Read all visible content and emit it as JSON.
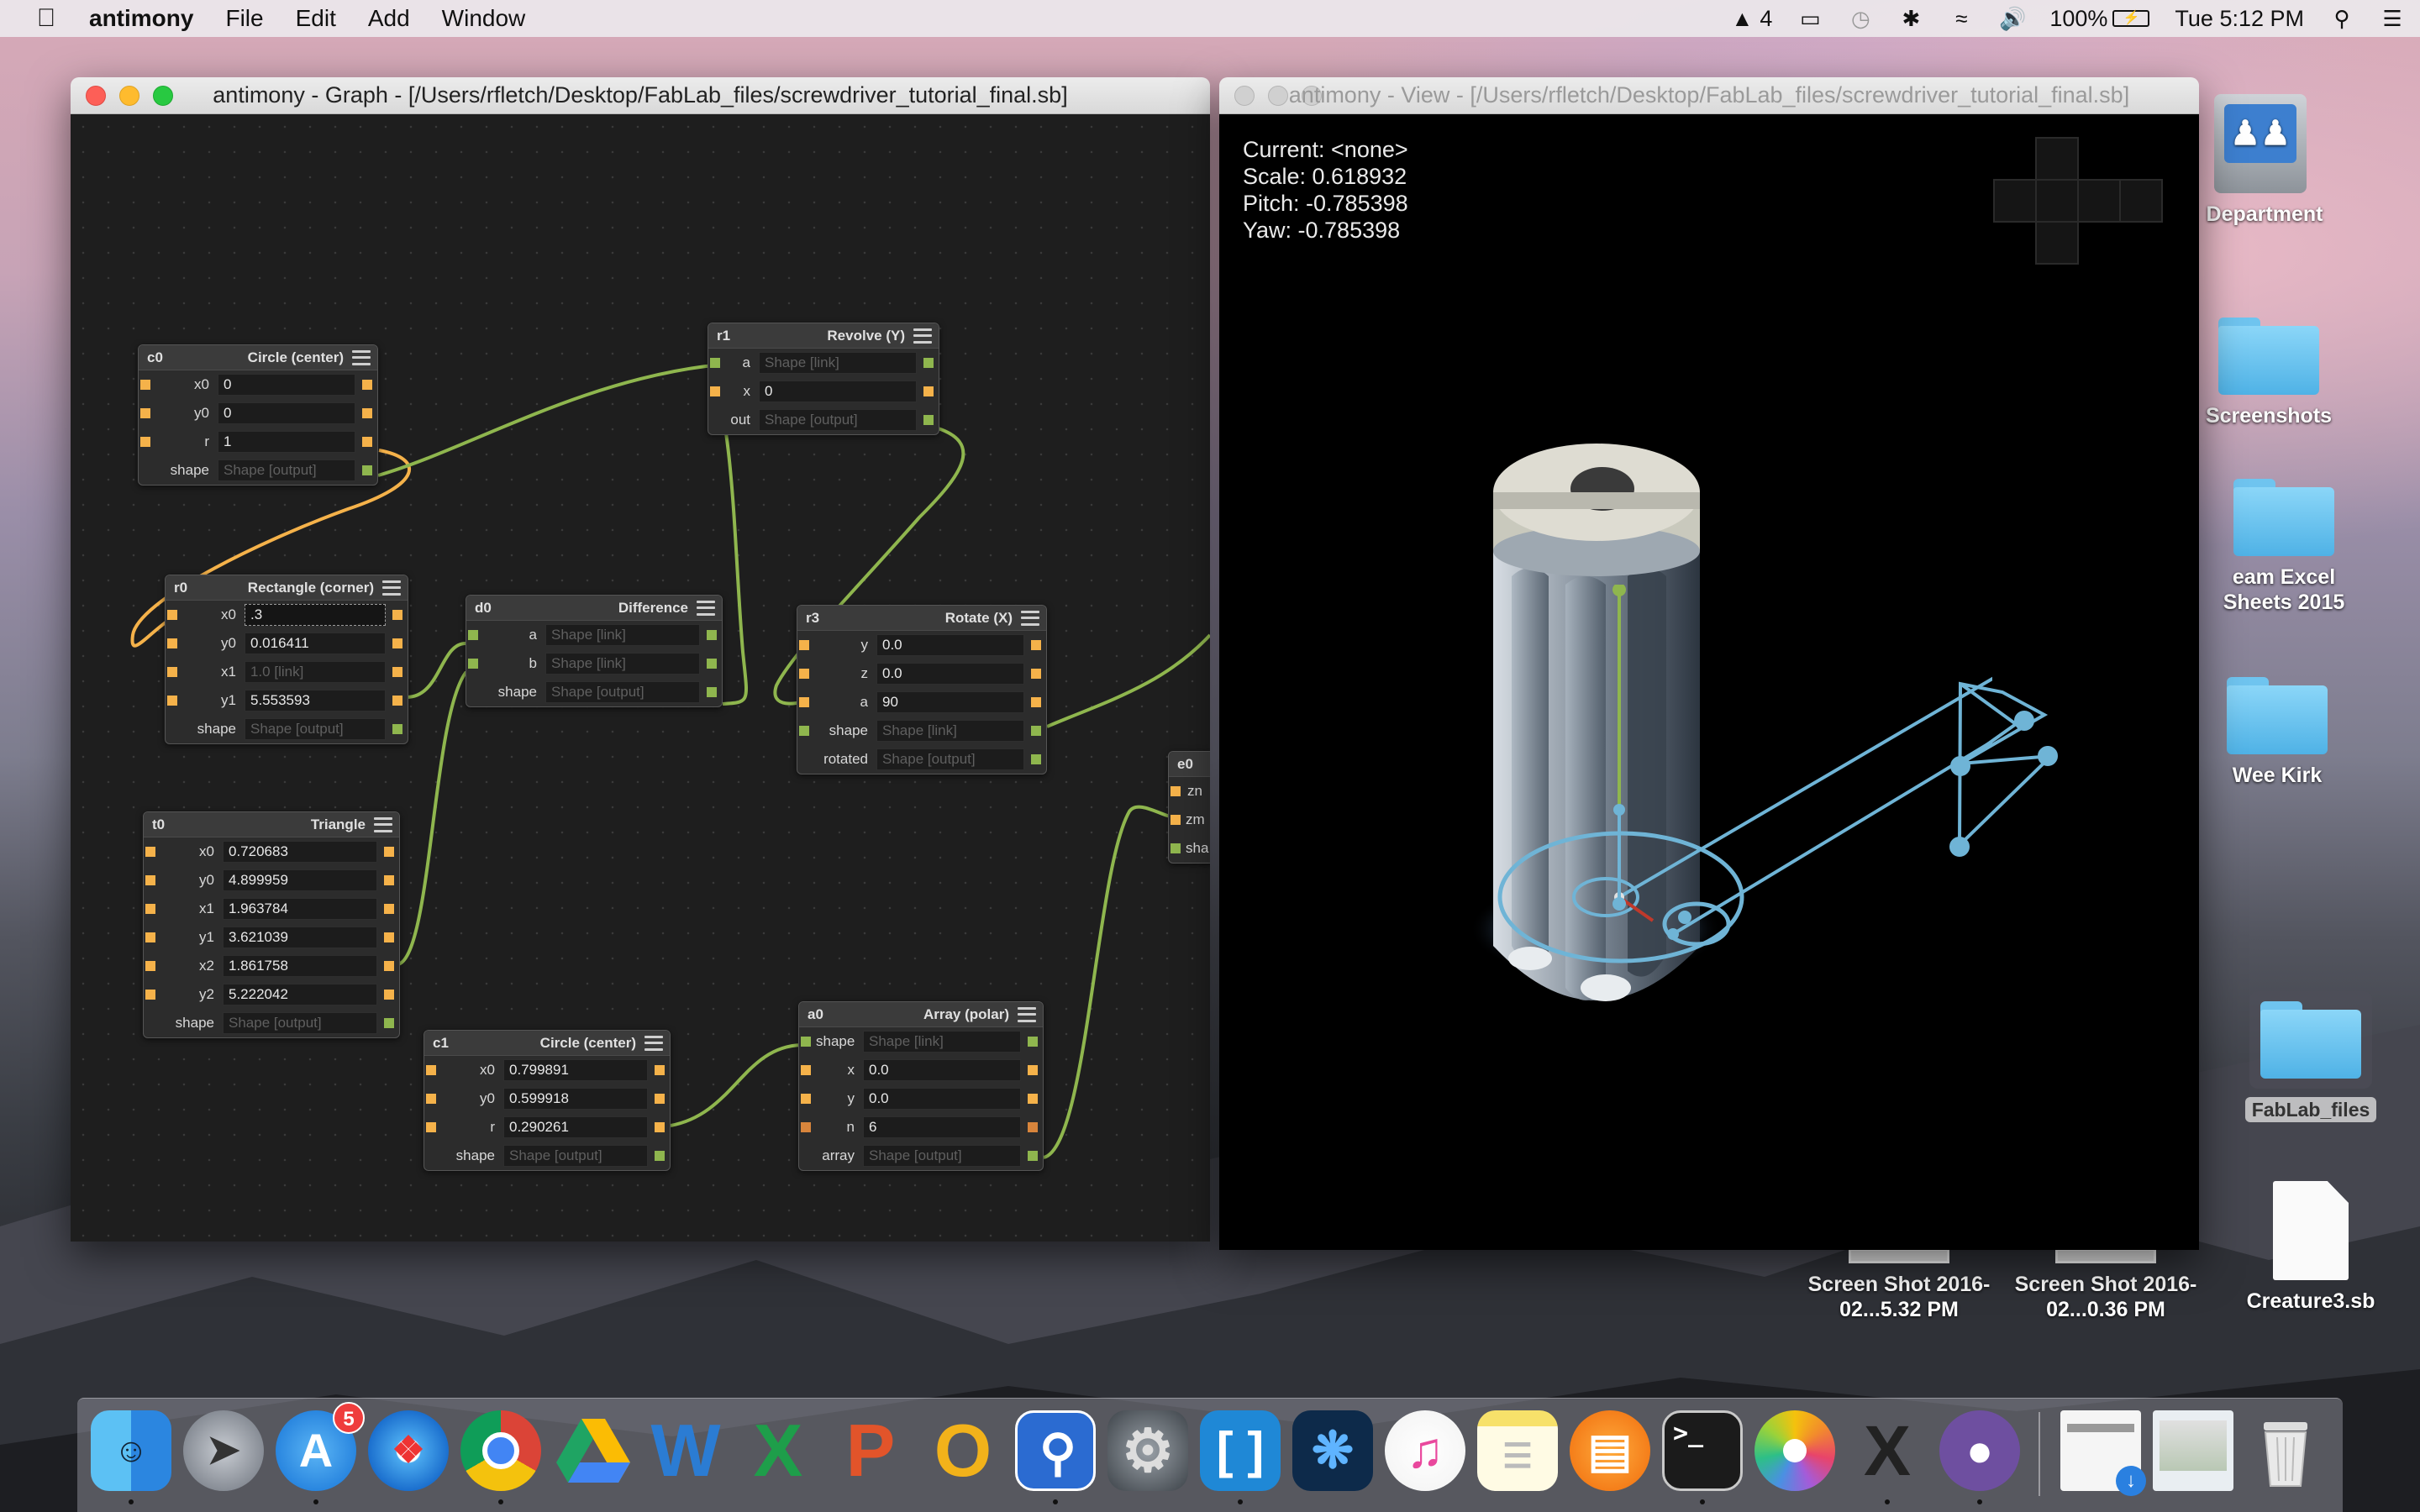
{
  "menubar": {
    "app_name": "antimony",
    "menus": [
      "File",
      "Edit",
      "Add",
      "Window"
    ],
    "adobe_badge": "4",
    "battery": "100%",
    "clock": "Tue 5:12 PM"
  },
  "graph_window": {
    "title": "antimony - Graph - [/Users/rfletch/Desktop/FabLab_files/screwdriver_tutorial_final.sb]",
    "nodes": {
      "c0": {
        "name": "c0",
        "type": "Circle (center)",
        "rows": [
          {
            "label": "x0",
            "value": "0"
          },
          {
            "label": "y0",
            "value": "0"
          },
          {
            "label": "r",
            "value": "1"
          },
          {
            "label": "shape",
            "value": "Shape [output]"
          }
        ]
      },
      "r0": {
        "name": "r0",
        "type": "Rectangle (corner)",
        "rows": [
          {
            "label": "x0",
            "value": ".3"
          },
          {
            "label": "y0",
            "value": "0.016411"
          },
          {
            "label": "x1",
            "value": "1.0 [link]"
          },
          {
            "label": "y1",
            "value": "5.553593"
          },
          {
            "label": "shape",
            "value": "Shape [output]"
          }
        ]
      },
      "t0": {
        "name": "t0",
        "type": "Triangle",
        "rows": [
          {
            "label": "x0",
            "value": "0.720683"
          },
          {
            "label": "y0",
            "value": "4.899959"
          },
          {
            "label": "x1",
            "value": "1.963784"
          },
          {
            "label": "y1",
            "value": "3.621039"
          },
          {
            "label": "x2",
            "value": "1.861758"
          },
          {
            "label": "y2",
            "value": "5.222042"
          },
          {
            "label": "shape",
            "value": "Shape [output]"
          }
        ]
      },
      "r1": {
        "name": "r1",
        "type": "Revolve (Y)",
        "rows": [
          {
            "label": "a",
            "value": "Shape [link]"
          },
          {
            "label": "x",
            "value": "0"
          },
          {
            "label": "out",
            "value": "Shape [output]"
          }
        ]
      },
      "d0": {
        "name": "d0",
        "type": "Difference",
        "rows": [
          {
            "label": "a",
            "value": "Shape [link]"
          },
          {
            "label": "b",
            "value": "Shape [link]"
          },
          {
            "label": "shape",
            "value": "Shape [output]"
          }
        ]
      },
      "r3": {
        "name": "r3",
        "type": "Rotate (X)",
        "rows": [
          {
            "label": "y",
            "value": "0.0"
          },
          {
            "label": "z",
            "value": "0.0"
          },
          {
            "label": "a",
            "value": "90"
          },
          {
            "label": "shape",
            "value": "Shape [link]"
          },
          {
            "label": "rotated",
            "value": "Shape [output]"
          }
        ]
      },
      "c1": {
        "name": "c1",
        "type": "Circle (center)",
        "rows": [
          {
            "label": "x0",
            "value": "0.799891"
          },
          {
            "label": "y0",
            "value": "0.599918"
          },
          {
            "label": "r",
            "value": "0.290261"
          },
          {
            "label": "shape",
            "value": "Shape [output]"
          }
        ]
      },
      "a0": {
        "name": "a0",
        "type": "Array (polar)",
        "rows": [
          {
            "label": "shape",
            "value": "Shape [link]"
          },
          {
            "label": "x",
            "value": "0.0"
          },
          {
            "label": "y",
            "value": "0.0"
          },
          {
            "label": "n",
            "value": "6"
          },
          {
            "label": "array",
            "value": "Shape [output]"
          }
        ]
      },
      "e0": {
        "name": "e0",
        "rows": [
          {
            "label": "zn"
          },
          {
            "label": "zm"
          },
          {
            "label": "sha"
          }
        ]
      }
    }
  },
  "view_window": {
    "title": "antimony - View - [/Users/rfletch/Desktop/FabLab_files/screwdriver_tutorial_final.sb]",
    "current": "Current: <none>",
    "scale": "Scale: 0.618932",
    "pitch": "Pitch: -0.785398",
    "yaw": "Yaw: -0.785398"
  },
  "desktop": {
    "icons": [
      {
        "label": "Department"
      },
      {
        "label": "Screenshots"
      },
      {
        "label": "eam Excel Sheets 2015"
      },
      {
        "label": "Wee Kirk"
      },
      {
        "label": "FabLab_files"
      },
      {
        "label": "Creature3.sb"
      },
      {
        "label": "Screen Shot 2016-02...5.32 PM"
      },
      {
        "label": "Screen Shot 2016-02...0.36 PM"
      }
    ]
  },
  "dock": {
    "app_store_badge": "5",
    "apps": [
      "finder",
      "launchpad",
      "app-store",
      "safari",
      "chrome",
      "google-drive",
      "word",
      "excel",
      "powerpoint",
      "outlook",
      "antimony",
      "system-preferences",
      "brackets",
      "xcode-instruments",
      "itunes",
      "notes",
      "ibooks",
      "terminal",
      "photos",
      "x11",
      "github"
    ]
  },
  "colors": {
    "graph_bg": "#1e1e1e",
    "wire_green": "#8fb64e",
    "wire_orange": "#f5b24a",
    "pin_orange": "#f5b24a",
    "pin_green": "#8fb64e",
    "view_bg": "#000000",
    "gizmo_blue": "#6fb4d6"
  }
}
